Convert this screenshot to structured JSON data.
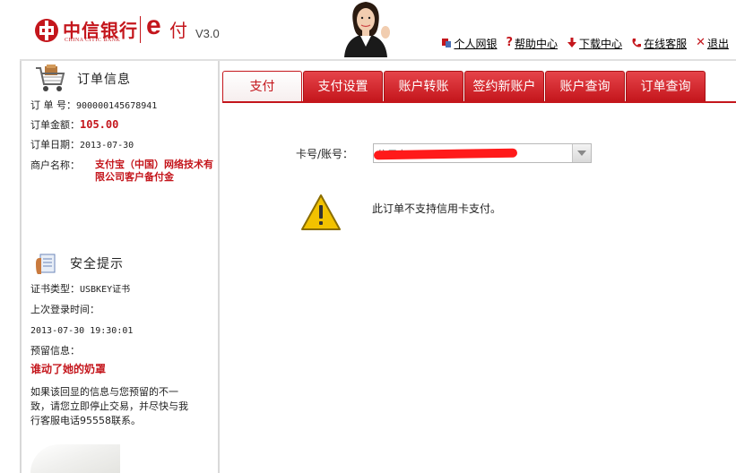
{
  "header": {
    "bank_name_cn": "中信银行",
    "bank_name_en": "CHINA CITIC BANK",
    "product_e": "e",
    "product_fu": "付",
    "version": "V3.0",
    "links": [
      {
        "label": "个人网银",
        "icon": "person-icon"
      },
      {
        "label": "帮助中心",
        "icon": "help-icon"
      },
      {
        "label": "下载中心",
        "icon": "download-icon"
      },
      {
        "label": "在线客服",
        "icon": "phone-icon"
      },
      {
        "label": "退出",
        "icon": "close-icon"
      }
    ]
  },
  "sidebar": {
    "order_title": "订单信息",
    "order_no_label": "订 单 号：",
    "order_no": "900000145678941",
    "amount_label": "订单金额：",
    "amount": "105.00",
    "date_label": "订单日期：",
    "date": "2013-07-30",
    "merchant_label": "商户名称：",
    "merchant": "支付宝（中国）网络技术有限公司客户备付金",
    "security_title": "安全提示",
    "cert_label": "证书类型：",
    "cert_value": "USBKEY证书",
    "last_login_label": "上次登录时间：",
    "last_login": "2013-07-30 19:30:01",
    "reserved_label": "预留信息：",
    "reserved_value": "谁动了她的奶罩",
    "note": "如果该回显的信息与您预留的不一致，请您立即停止交易，并尽快与我行客服电话95558联系。"
  },
  "tabs": [
    {
      "label": "支付",
      "active": true
    },
    {
      "label": "支付设置",
      "active": false
    },
    {
      "label": "账户转账",
      "active": false
    },
    {
      "label": "签约新账户",
      "active": false
    },
    {
      "label": "账户查询",
      "active": false
    },
    {
      "label": "订单查询",
      "active": false
    }
  ],
  "main": {
    "card_label": "卡号/账号：",
    "card_value": "信用卡",
    "notice": "此订单不支持信用卡支付。"
  },
  "colors": {
    "brand_red": "#c4161c",
    "warning_yellow": "#f2c200"
  }
}
